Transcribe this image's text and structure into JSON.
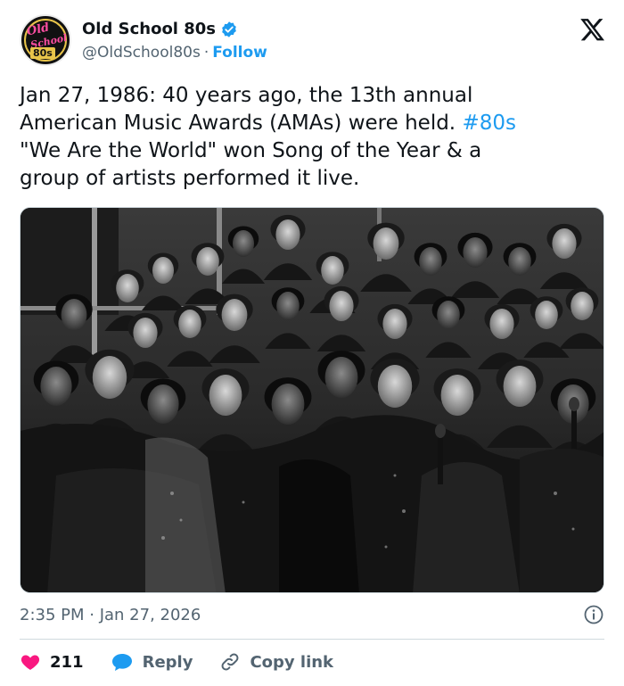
{
  "header": {
    "display_name": "Old School 80s",
    "handle": "@OldSchool80s",
    "separator": "·",
    "follow_label": "Follow",
    "avatar_text": [
      "Old",
      "School",
      "80s"
    ]
  },
  "tweet": {
    "line1": "Jan 27, 1986: 40 years ago, the 13th annual",
    "line2": "American Music Awards (AMAs) were held.",
    "hashtag": "#80s",
    "line3": "\"We Are the World\" won Song of the Year & a",
    "line4": "group of artists performed it live."
  },
  "media": {
    "description_icon": "photo"
  },
  "meta": {
    "timestamp": "2:35 PM · Jan 27, 2026"
  },
  "actions": {
    "like_count": "211",
    "reply_label": "Reply",
    "copy_label": "Copy link"
  },
  "colors": {
    "accent": "#1d9bf0",
    "like": "#f91880",
    "text": "#0f1419",
    "muted": "#536471"
  }
}
